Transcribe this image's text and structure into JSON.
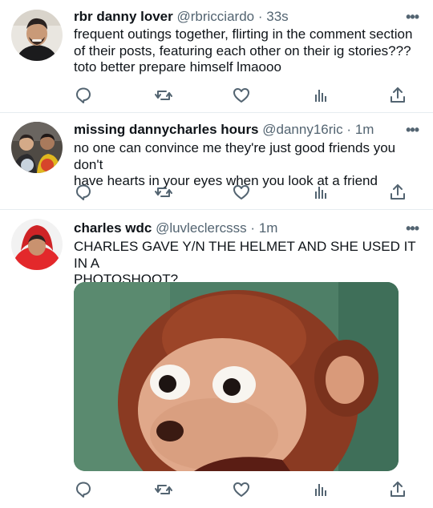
{
  "tweets": [
    {
      "display_name": "rbr danny lover",
      "handle": "@rbricciardo",
      "separator": "·",
      "time": "33s",
      "lines": [
        "frequent outings together, flirting in the comment section",
        "of their posts, featuring each other on their ig stories???",
        "toto better prepare himself lmaooo"
      ]
    },
    {
      "display_name": "missing dannycharles hours",
      "handle": "@danny16ric",
      "separator": "·",
      "time": "1m",
      "lines": [
        "no one can convince me they're just good friends you don't",
        "have hearts in your eyes when you look at a friend"
      ]
    },
    {
      "display_name": "charles wdc",
      "handle": "@luvleclercsss",
      "separator": "·",
      "time": "1m",
      "lines": [
        "CHARLES GAVE Y/N THE HELMET AND SHE USED IT IN A",
        "PHOTOSHOOT?"
      ]
    }
  ],
  "more_icon": "•••",
  "icons": [
    "reply-icon",
    "retweet-icon",
    "like-icon",
    "analytics-icon",
    "share-icon"
  ],
  "colors": {
    "icon": "#536471",
    "divider": "#e6ecf0",
    "text": "#0f1419",
    "secondary": "#536471"
  }
}
